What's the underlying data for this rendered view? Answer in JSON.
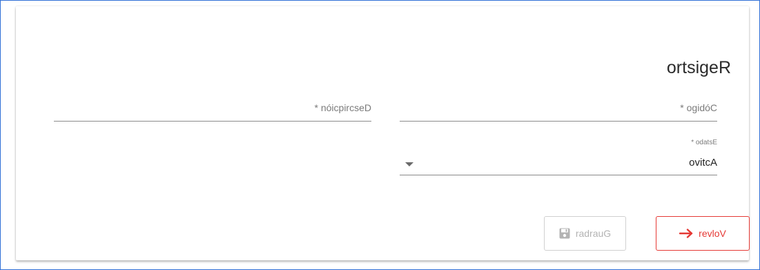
{
  "form": {
    "title": "Registro",
    "fields": {
      "codigo": {
        "label": "Código *"
      },
      "descripcion": {
        "label": "Descripción *"
      },
      "estado": {
        "label": "Estado *",
        "value": "Activo"
      }
    }
  },
  "actions": {
    "volver_label": "Volver",
    "guardar_label": "Guardar"
  },
  "colors": {
    "frame_border": "#2f6fd6",
    "accent_red": "#e53935",
    "disabled_gray": "#b3b3b3"
  },
  "icons": {
    "volver": "arrow-right-icon",
    "guardar": "floppy-disk-icon",
    "estado": "dropdown-caret-icon"
  }
}
